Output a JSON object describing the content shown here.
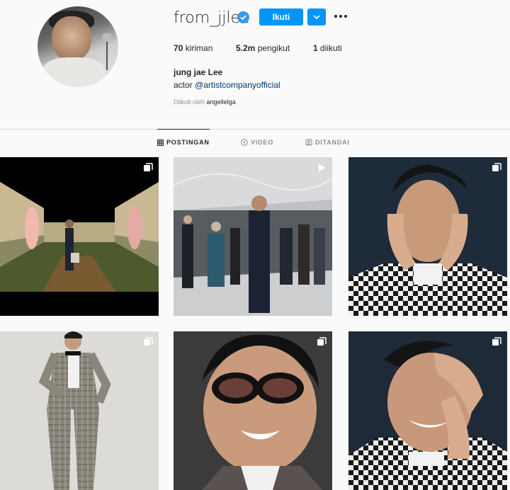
{
  "profile": {
    "username": "from_jjlee",
    "follow_label": "Ikuti",
    "stats": {
      "posts_count": "70",
      "posts_label": "kiriman",
      "followers_count": "5.2m",
      "followers_label": "pengikut",
      "following_count": "1",
      "following_label": "diikuti"
    },
    "full_name": "jung jae Lee",
    "bio_text": "actor",
    "bio_link": "@artistcompanyofficial",
    "followed_by_label": "Diikuti oleh",
    "followed_by_user": "angellelga"
  },
  "tabs": [
    {
      "label": "POSTINGAN",
      "icon": "grid-icon",
      "active": true
    },
    {
      "label": "VIDEO",
      "icon": "play-circle-icon",
      "active": false
    },
    {
      "label": "DITANDAI",
      "icon": "tag-icon",
      "active": false
    }
  ],
  "posts": [
    {
      "badge": "carousel-icon"
    },
    {
      "badge": "reel-icon"
    },
    {
      "badge": "carousel-icon"
    },
    {
      "badge": "carousel-icon"
    },
    {
      "badge": "carousel-icon"
    },
    {
      "badge": "carousel-icon"
    }
  ],
  "colors": {
    "accent": "#0095f6",
    "verified": "#3897f0",
    "link": "#00376b"
  }
}
